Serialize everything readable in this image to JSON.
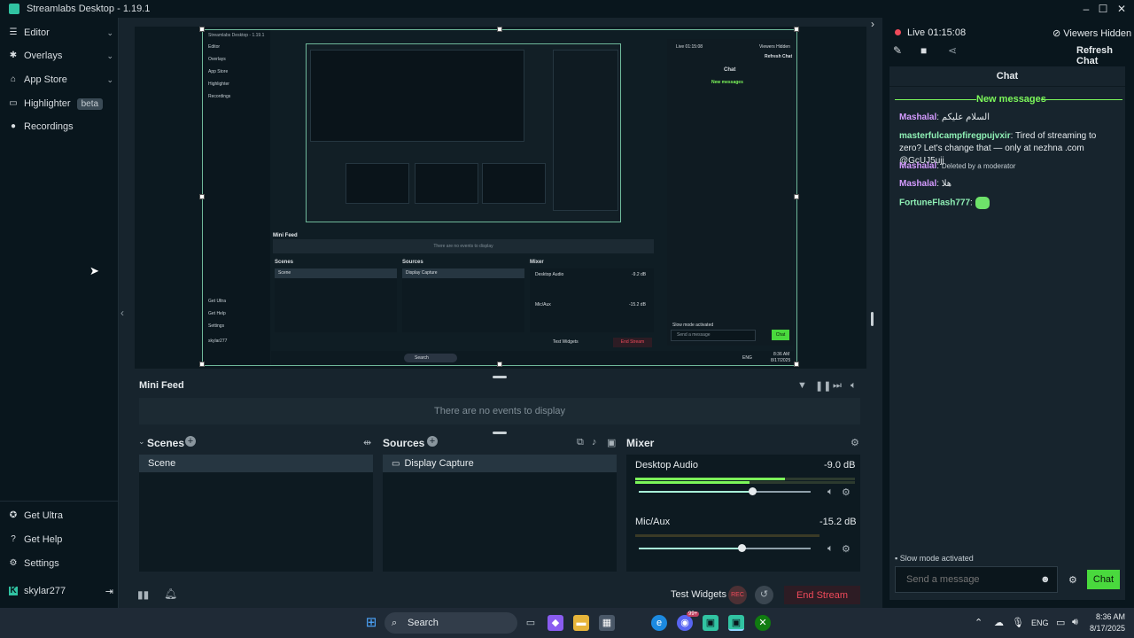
{
  "app": {
    "title": "Streamlabs Desktop - 1.19.1"
  },
  "sidebar": {
    "items": [
      {
        "label": "Editor",
        "icon": "editor-icon"
      },
      {
        "label": "Overlays",
        "icon": "overlays-icon"
      },
      {
        "label": "App Store",
        "icon": "app-store-icon"
      },
      {
        "label": "Highlighter",
        "icon": "highlighter-icon",
        "badge": "beta"
      },
      {
        "label": "Recordings",
        "icon": "recordings-icon"
      }
    ],
    "bottom": [
      {
        "label": "Get Ultra",
        "icon": "ultra-icon"
      },
      {
        "label": "Get Help",
        "icon": "help-icon"
      },
      {
        "label": "Settings",
        "icon": "gear-icon"
      }
    ],
    "user": "skylar277"
  },
  "minifeed": {
    "title": "Mini Feed",
    "empty": "There are no events to display"
  },
  "scenes": {
    "title": "Scenes",
    "items": [
      "Scene"
    ]
  },
  "sources": {
    "title": "Sources",
    "items": [
      "Display Capture"
    ]
  },
  "mixer": {
    "title": "Mixer",
    "channels": [
      {
        "name": "Desktop Audio",
        "db": "-9.0 dB",
        "level": 0.66
      },
      {
        "name": "Mic/Aux",
        "db": "-15.2 dB",
        "level": 0.6
      }
    ]
  },
  "footer": {
    "test_widgets": "Test Widgets",
    "end_stream": "End Stream"
  },
  "live": {
    "status": "Live",
    "time": "01:15:08",
    "viewers": "Viewers Hidden",
    "refresh": "Refresh Chat"
  },
  "chat": {
    "title": "Chat",
    "new_messages": "New messages",
    "messages": [
      {
        "name": "Mashalal",
        "text": "السلام عليكم",
        "color": "#d59bff"
      },
      {
        "name": "masterfulcampfiregpujvxir",
        "text": "Tired of streaming to zero? Let's change that — only at nezhna .com @GcUJ5ujj",
        "color": "#8ff0b5"
      },
      {
        "name": "Mashalal",
        "text": "Deleted by a moderator",
        "color": "#d59bff"
      },
      {
        "name": "Mashalal",
        "text": "هلا",
        "color": "#d59bff"
      },
      {
        "name": "FortuneFlash777",
        "text": "",
        "color": "#8ff0b5"
      }
    ],
    "slow_mode": "Slow mode activated",
    "placeholder": "Send a message",
    "send": "Chat"
  },
  "nested": {
    "sidebar_items": [
      "Editor",
      "Overlays",
      "App Store",
      "Highlighter",
      "Recordings"
    ],
    "sidebar_bottom": [
      "Get Ultra",
      "Get Help",
      "Settings"
    ],
    "user": "skylar277",
    "title": "Streamlabs Desktop - 1.19.1",
    "minifeed": "Mini Feed",
    "empty": "There are no events to display",
    "scenes": "Scenes",
    "sources": "Sources",
    "mixer": "Mixer",
    "scene": "Scene",
    "source": "Display Capture",
    "ch1": "Desktop Audio",
    "ch1db": "-9.2 dB",
    "ch2": "Mic/Aux",
    "ch2db": "-15.2 dB",
    "live": "Live 01:15:08",
    "viewers": "Viewers Hidden",
    "refresh": "Refresh Chat",
    "chat": "Chat",
    "new_messages": "New messages",
    "slow_mode": "Slow mode activated",
    "placeholder": "Send a message",
    "send": "Chat",
    "test_widgets": "Test Widgets",
    "end_stream": "End Stream",
    "search": "Search",
    "lang": "ENG",
    "time": "8:36 AM",
    "date": "8/17/2025"
  },
  "taskbar": {
    "search": "Search",
    "lang": "ENG",
    "time": "8:36 AM",
    "date": "8/17/2025",
    "notif": "99+"
  }
}
